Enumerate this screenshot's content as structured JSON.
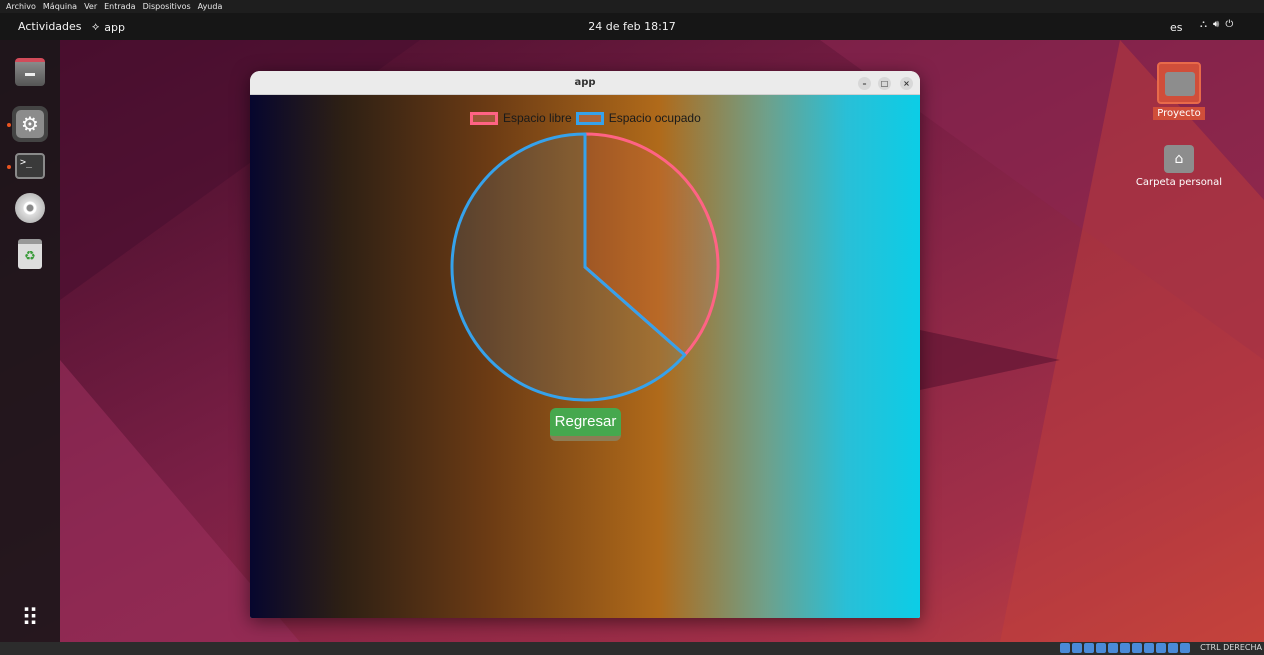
{
  "vbox_menu": [
    "Archivo",
    "Máquina",
    "Ver",
    "Entrada",
    "Dispositivos",
    "Ayuda"
  ],
  "topbar": {
    "activities": "Actividades",
    "app": "app",
    "clock": "24 de feb  18:17",
    "lang": "es"
  },
  "desktop_icons": {
    "project": "Proyecto",
    "home": "Carpeta personal"
  },
  "window": {
    "title": "app",
    "minimize": "–",
    "maximize": "□",
    "close": "×"
  },
  "legend": {
    "free": "Espacio libre",
    "used": "Espacio ocupado"
  },
  "button": {
    "back": "Regresar"
  },
  "taskbar": {
    "host_key": "CTRL DERECHA"
  },
  "colors": {
    "free": "#ff6384",
    "used": "#36a2eb",
    "button": "#46a84e"
  },
  "chart_data": {
    "type": "pie",
    "categories": [
      "Espacio libre",
      "Espacio ocupado"
    ],
    "values": [
      36.5,
      63.5
    ],
    "legend_placement": "top"
  }
}
